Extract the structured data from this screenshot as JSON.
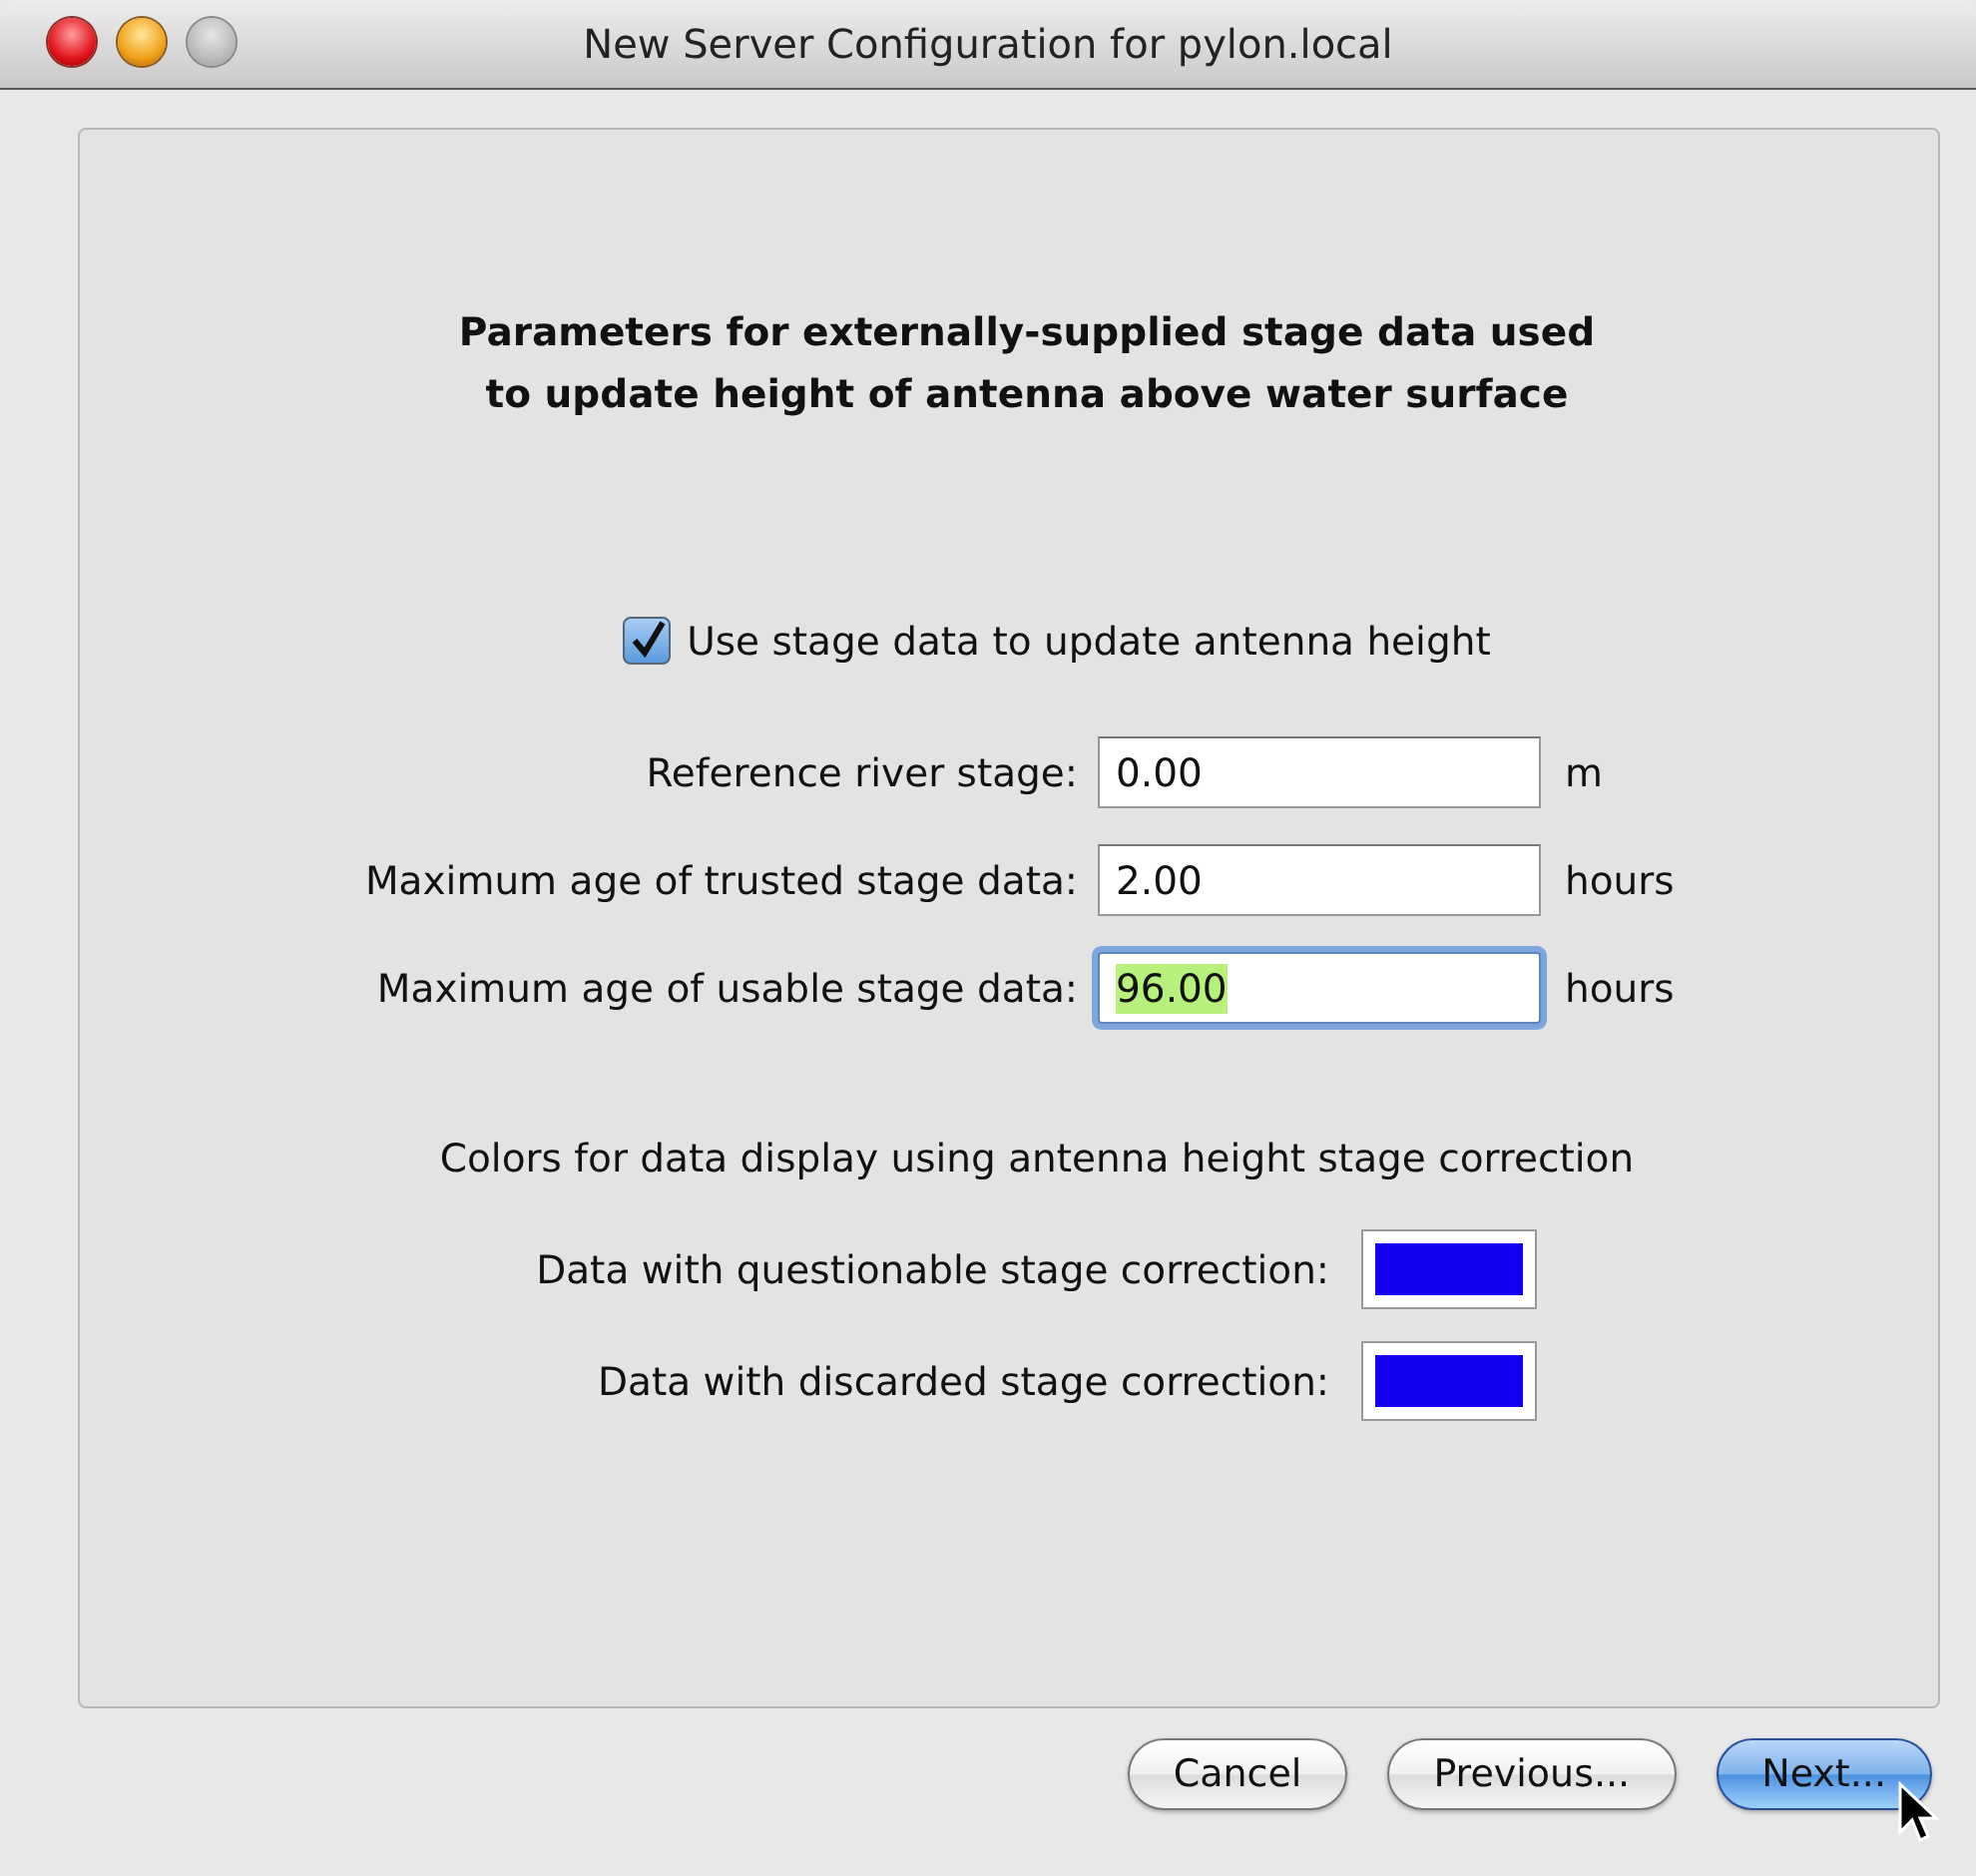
{
  "window": {
    "title": "New Server Configuration for pylon.local"
  },
  "heading_lines": [
    "Parameters for externally-supplied stage data used",
    "to update height of antenna above water surface"
  ],
  "stage_checkbox": {
    "label": "Use stage data to update antenna height",
    "checked": true
  },
  "fields": [
    {
      "label": "Reference river stage:",
      "value": "0.00",
      "unit": "m",
      "focused": false
    },
    {
      "label": "Maximum age of trusted stage data:",
      "value": "2.00",
      "unit": "hours",
      "focused": false
    },
    {
      "label": "Maximum age of usable stage data:",
      "value": "96.00",
      "unit": "hours",
      "focused": true
    }
  ],
  "colors_heading": "Colors for data display using antenna height stage correction",
  "color_rows": [
    {
      "label": "Data with questionable stage correction:",
      "color": "#1400f0"
    },
    {
      "label": "Data with discarded stage correction:",
      "color": "#1400f0"
    }
  ],
  "buttons": [
    {
      "label": "Cancel",
      "default": false
    },
    {
      "label": "Previous...",
      "default": false
    },
    {
      "label": "Next...",
      "default": true
    }
  ]
}
